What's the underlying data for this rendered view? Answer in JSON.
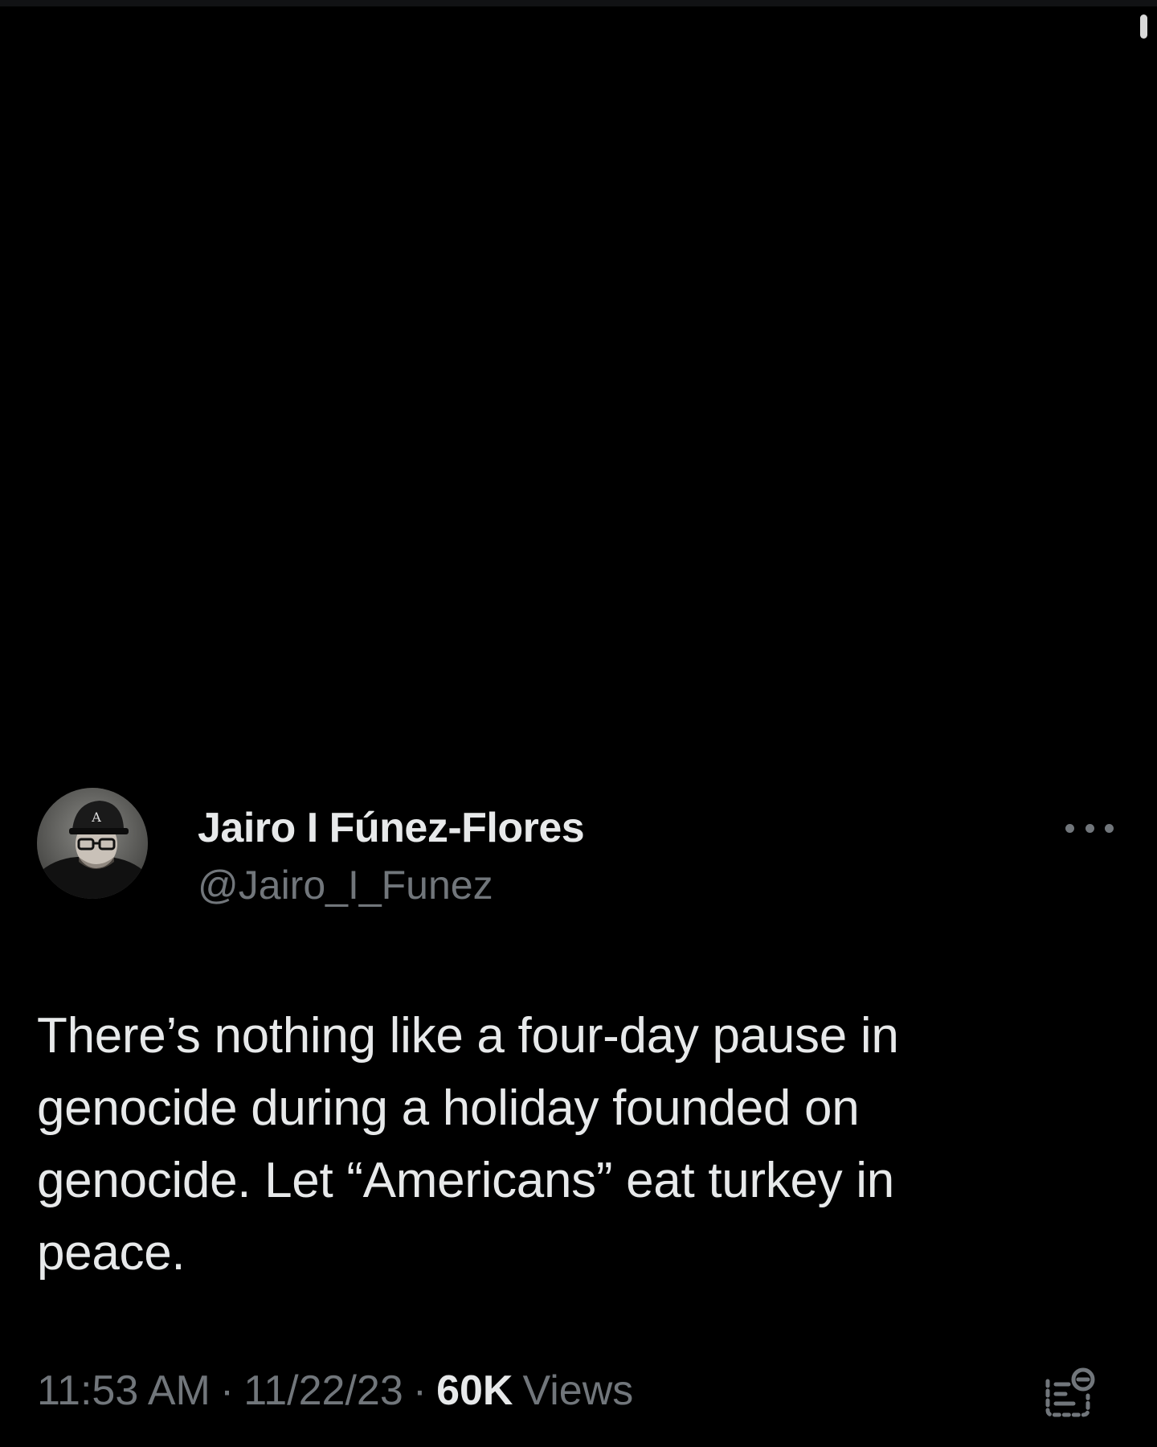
{
  "tweet": {
    "author": {
      "display_name": "Jairo I Fúnez-Flores",
      "handle": "@Jairo_I_Funez",
      "avatar_icon": "profile-photo-avatar"
    },
    "text": "There’s nothing like a four-day pause in genocide during a holiday founded on genocide. Let “Americans” eat turkey in peace.",
    "time": "11:53 AM",
    "date": "11/22/23",
    "separator": "·",
    "views_count": "60K",
    "views_label": "Views",
    "more_icon": "more-dots-icon",
    "stats_icon": "post-analytics-icon"
  },
  "colors": {
    "background": "#000000",
    "primary_text": "#e7e9ea",
    "secondary_text": "#71767b"
  }
}
